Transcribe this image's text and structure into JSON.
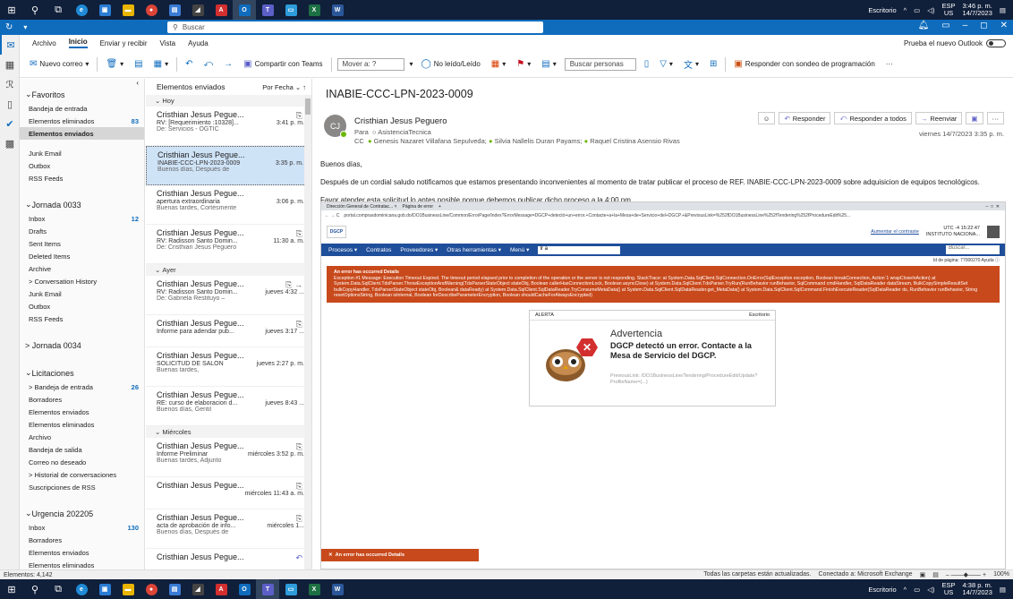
{
  "taskbar": {
    "desk_label": "Escritorio",
    "lang": "ESP",
    "lang_sub": "US",
    "top_time": "3:46 p. m.",
    "top_date": "14/7/2023",
    "bottom_time": "4:38 p. m.",
    "bottom_date": "14/7/2023"
  },
  "titlebar": {
    "search_placeholder": "Buscar"
  },
  "menu": {
    "items": [
      "Archivo",
      "Inicio",
      "Enviar y recibir",
      "Vista",
      "Ayuda"
    ],
    "try_new": "Prueba el nuevo Outlook"
  },
  "ribbon": {
    "new_mail": "Nuevo correo",
    "teams": "Compartir con Teams",
    "move": "Mover a: ?",
    "unread": "No leído/Leído",
    "search_people": "Buscar personas",
    "survey": "Responder con sondeo de programación"
  },
  "folders": {
    "favoritos": "Favoritos",
    "fav_items": [
      {
        "label": "Bandeja de entrada",
        "count": ""
      },
      {
        "label": "Elementos eliminados",
        "count": "83"
      },
      {
        "label": "Elementos enviados",
        "count": ""
      }
    ],
    "misc": [
      "Junk Email",
      "Outbox",
      "RSS Feeds"
    ],
    "jornada33": "Jornada 0033",
    "j33_items": [
      {
        "label": "Inbox",
        "count": "12"
      },
      {
        "label": "Drafts",
        "count": ""
      },
      {
        "label": "Sent Items",
        "count": ""
      },
      {
        "label": "Deleted Items",
        "count": ""
      },
      {
        "label": "Archive",
        "count": ""
      },
      {
        "label": "> Conversation History",
        "count": ""
      },
      {
        "label": "Junk Email",
        "count": ""
      },
      {
        "label": "Outbox",
        "count": ""
      },
      {
        "label": "RSS Feeds",
        "count": ""
      }
    ],
    "jornada34": "> Jornada 0034",
    "licitaciones": "Licitaciones",
    "lic_items": [
      {
        "label": "> Bandeja de entrada",
        "count": "26"
      },
      {
        "label": "Borradores",
        "count": ""
      },
      {
        "label": "Elementos enviados",
        "count": ""
      },
      {
        "label": "Elementos eliminados",
        "count": ""
      },
      {
        "label": "Archivo",
        "count": ""
      },
      {
        "label": "Bandeja de salida",
        "count": ""
      },
      {
        "label": "Correo no deseado",
        "count": ""
      },
      {
        "label": "> Historial de conversaciones",
        "count": ""
      },
      {
        "label": "Suscripciones de RSS",
        "count": ""
      }
    ],
    "urgencia": "Urgencia 202205",
    "urg_items": [
      {
        "label": "Inbox",
        "count": "130"
      },
      {
        "label": "Borradores",
        "count": ""
      },
      {
        "label": "Elementos enviados",
        "count": ""
      },
      {
        "label": "Elementos eliminados",
        "count": ""
      }
    ]
  },
  "list": {
    "title": "Elementos enviados",
    "sort": "Por Fecha",
    "groups": [
      "Hoy",
      "Ayer",
      "Miércoles"
    ],
    "items": [
      {
        "from": "Cristhian Jesus Pegue...",
        "subject": "RV: [Requerimiento :10328]...",
        "time": "3:41 p. m.",
        "preview": "De: Servicios - OGTIC"
      },
      {
        "from": "Cristhian Jesus Pegue...",
        "subject": "INABIE-CCC-LPN-2023-0009",
        "time": "3:35 p. m.",
        "preview": "Buenos días,  Después de"
      },
      {
        "from": "Cristhian Jesus Pegue...",
        "subject": "apertura extraordinaria",
        "time": "3:06 p. m.",
        "preview": "Buenas tardes,  Cortésmente"
      },
      {
        "from": "Cristhian Jesus Pegue...",
        "subject": "RV: Radisson Santo Domin...",
        "time": "11:30 a. m.",
        "preview": "De: Cristhian Jesus Peguero"
      },
      {
        "from": "Cristhian Jesus Pegue...",
        "subject": "RV: Radisson Santo Domin...",
        "time": "jueves 4:32 ...",
        "preview": "De: Gabriela Restituyo –"
      },
      {
        "from": "Cristhian Jesus Pegue...",
        "subject": "Informe para adendar pub...",
        "time": "jueves 3:17 ...",
        "preview": ""
      },
      {
        "from": "Cristhian Jesus Pegue...",
        "subject": "SOLICITUD DE SALON",
        "time": "jueves 2:27 p. m.",
        "preview": "Buenas tardes,"
      },
      {
        "from": "Cristhian Jesus Pegue...",
        "subject": "RE: curso de elaboracion d...",
        "time": "jueves 8:43 ...",
        "preview": "Buenos días,  Gentil"
      },
      {
        "from": "Cristhian Jesus Pegue...",
        "subject": "Informe Preliminar",
        "time": "miércoles 3:52 p. m.",
        "preview": "Buenas tardes,  Adjunto"
      },
      {
        "from": "Cristhian Jesus Pegue...",
        "subject": "",
        "time": "miércoles 11:43 a. m.",
        "preview": ""
      },
      {
        "from": "Cristhian Jesus Pegue...",
        "subject": "acta de aprobación de info...",
        "time": "miércoles 1...",
        "preview": "Buenos días,  Después de"
      },
      {
        "from": "Cristhian Jesus Pegue...",
        "subject": "",
        "time": "",
        "preview": ""
      }
    ]
  },
  "email": {
    "subject": "INABIE-CCC-LPN-2023-0009",
    "initials": "CJ",
    "from": "Cristhian Jesus Peguero",
    "to_label": "Para",
    "to": "AsistenciaTecnica",
    "cc_label": "CC",
    "cc": [
      "Genesis Nazaret Villafana Sepulveda;",
      "Silvia Nallelis Duran Payams;",
      "Raquel Cristina Asensio Rivas"
    ],
    "reply": "Responder",
    "reply_all": "Responder a todos",
    "forward": "Reenviar",
    "date": "viernes 14/7/2023 3:35 p. m.",
    "greeting": "Buenos días,",
    "body1": "Después de un cordial saludo notificamos que estamos presentando inconvenientes al momento de tratar publicar el proceso de REF. INABIE-CCC-LPN-2023-0009 sobre adquisicion de equipos tecnológicos.",
    "body2": "Favor atender esta solicitud lo antes posible porque debemos publicar dicho proceso a la 4:00 pm."
  },
  "screenshot": {
    "tab1": "Dirección General de Contratac... ×",
    "tab2": "Página de error",
    "url": "portal.comprasdominicana.gob.do/DO1BusinessLine/Common/ErrorPage/Index?ErrorMessage=DGCP+detectó+un+error.+Contacte+a+la+Mesa+de+Servicio+del+DGCP.+&PreviousLink=%252fDO1BusinessLine%252fTendering%252fProcedureEdit%25...",
    "contrast": "Aumentar el contraste",
    "utc": "UTC -4 15:22:47",
    "inst": "INSTITUTO NACIONA...",
    "nav": [
      "Procesos ▾",
      "Contratos",
      "Proveedores ▾",
      "Otras herramientas ▾",
      "Menú ▾"
    ],
    "ir_a": "Ir a",
    "buscar": "Buscar...",
    "page_id": "Id de página: 77000270   Ayuda ⓘ",
    "err_title": "An error has occurred Details",
    "err_text": "Exception #1 Message: Execution Timeout Expired. The timeout period elapsed prior to completion of the operation or the server is not responding. StackTrace: at System.Data.SqlClient.SqlConnection.OnError(SqlException exception, Boolean breakConnection, Action`1 wrapCloseInAction) at System.Data.SqlClient.TdsParser.ThrowExceptionAndWarning(TdsParserStateObject stateObj, Boolean callerHasConnectionLock, Boolean asyncClose) at System.Data.SqlClient.TdsParser.TryRun(RunBehavior runBehavior, SqlCommand cmdHandler, SqlDataReader dataStream, BulkCopySimpleResultSet bulkCopyHandler, TdsParserStateObject stateObj, Boolean& dataReady) at System.Data.SqlClient.SqlDataReader.TryConsumeMetaData() at System.Data.SqlClient.SqlDataReader.get_MetaData() at System.Data.SqlClient.SqlCommand.FinishExecuteReader(SqlDataReader ds, RunBehavior runBehavior, String resetOptionsString, Boolean isInternal, Boolean forDescribeParameterEncryption, Boolean shouldCacheForAlwaysEncrypted)",
    "alert_head": "ALERTA",
    "alert_right": "Escritorio",
    "adv_title": "Advertencia",
    "adv_msg": "DGCP detectó un error. Contacte a la Mesa de Servicio del DGCP.",
    "adv_link": "PreviousLink: /DO1BusinessLine/Tendering/ProcedureEdit/Update?ProfileName=(...)",
    "err2": "An error has occurred Details"
  },
  "status": {
    "left": "Elementos: 4,142",
    "sync": "Todas las carpetas están actualizadas.",
    "conn": "Conectado a: Microsoft Exchange",
    "zoom": "100%"
  }
}
